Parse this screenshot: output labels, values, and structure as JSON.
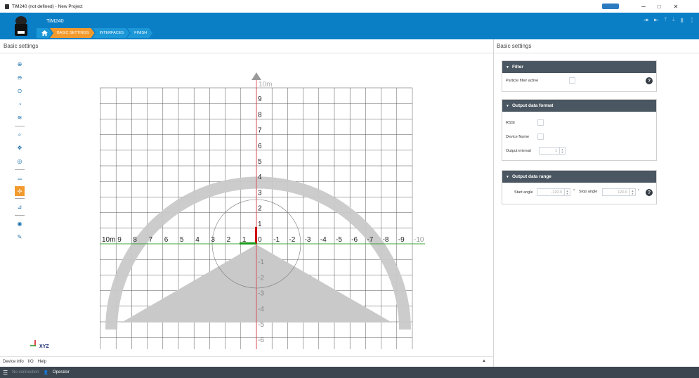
{
  "window": {
    "title": "TiM240 (not defined) - New Project",
    "minimize": "–",
    "maximize": "□",
    "close": "✕"
  },
  "header": {
    "device_name": "TiM240",
    "breadcrumbs": [
      "BASIC SETTINGS",
      "INTERFACES",
      "FINISH"
    ],
    "active_crumb": "BASIC SETTINGS",
    "accent_color": "#0b7fc6",
    "active_color": "#f39a2d"
  },
  "left": {
    "title": "Basic settings",
    "tools": [
      "zoom-in-icon",
      "zoom-out-icon",
      "zoom-fit-icon",
      "rotate-icon",
      "layers-icon",
      "search-icon",
      "pan-icon",
      "measure-icon",
      "field-edit-icon",
      "point-icon",
      "line-icon",
      "eye-icon",
      "pin-icon"
    ],
    "viewer": {
      "unit_label": "10m",
      "y_labels": [
        "9",
        "8",
        "7",
        "6",
        "5",
        "4",
        "3",
        "2",
        "1",
        "0",
        "-1",
        "-2",
        "-3",
        "-4",
        "-5",
        "-6",
        "-7"
      ],
      "x_labels": [
        "10m",
        "9",
        "8",
        "7",
        "6",
        "5",
        "4",
        "3",
        "2",
        "1",
        "0",
        "-1",
        "-2",
        "-3",
        "-4",
        "-5",
        "-6",
        "-7",
        "-8",
        "-9",
        "-10"
      ],
      "gizmo_label": "XYZ"
    },
    "bottom_tabs": [
      "Device info",
      "I/O",
      "Help"
    ]
  },
  "status": {
    "connection": "No connection",
    "user": "Operator"
  },
  "right": {
    "title": "Basic settings",
    "filter": {
      "heading": "Filter",
      "particle_label": "Particle filter active"
    },
    "output_format": {
      "heading": "Output data format",
      "rssi_label": "RSSI",
      "device_name_label": "Device Name",
      "interval_label": "Output interval",
      "interval_value": "1"
    },
    "output_range": {
      "heading": "Output data range",
      "start_label": "Start angle",
      "start_value": "-120.0",
      "stop_label": "Stop angle",
      "stop_value": "120.0",
      "unit": "°"
    }
  }
}
